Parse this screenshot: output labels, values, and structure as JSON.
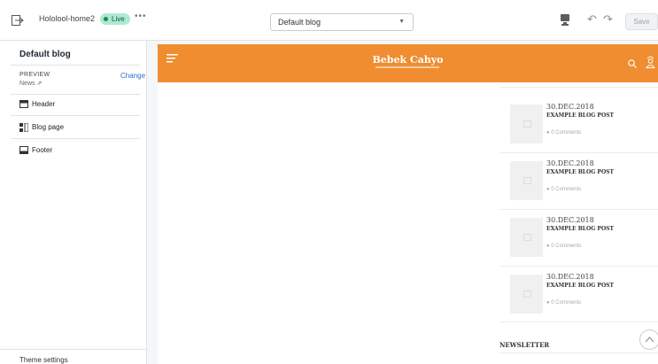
{
  "topbar": {
    "theme_name": "Hololool-home2",
    "live_badge": "Live",
    "more_label": "•••",
    "template_select": "Default blog",
    "save_label": "Save"
  },
  "sidebar": {
    "title": "Default blog",
    "preview_label": "PREVIEW",
    "preview_value": "News",
    "change_label": "Change",
    "sections": [
      {
        "label": "Header",
        "icon": "header-section-icon"
      },
      {
        "label": "Blog page",
        "icon": "blog-page-icon"
      },
      {
        "label": "Footer",
        "icon": "footer-section-icon"
      }
    ],
    "theme_settings_label": "Theme settings"
  },
  "preview": {
    "store_name": "Bebek Cahyo",
    "header_color": "#ef8d30",
    "posts": [
      {
        "date": "30.DEC.2018",
        "title": "EXAMPLE BLOG POST",
        "comments": "0 Comments"
      },
      {
        "date": "30.DEC.2018",
        "title": "EXAMPLE BLOG POST",
        "comments": "0 Comments"
      },
      {
        "date": "30.DEC.2018",
        "title": "EXAMPLE BLOG POST",
        "comments": "0 Comments"
      },
      {
        "date": "30.DEC.2018",
        "title": "EXAMPLE BLOG POST",
        "comments": "0 Comments"
      }
    ],
    "newsletter_title": "NEWSLETTER"
  }
}
